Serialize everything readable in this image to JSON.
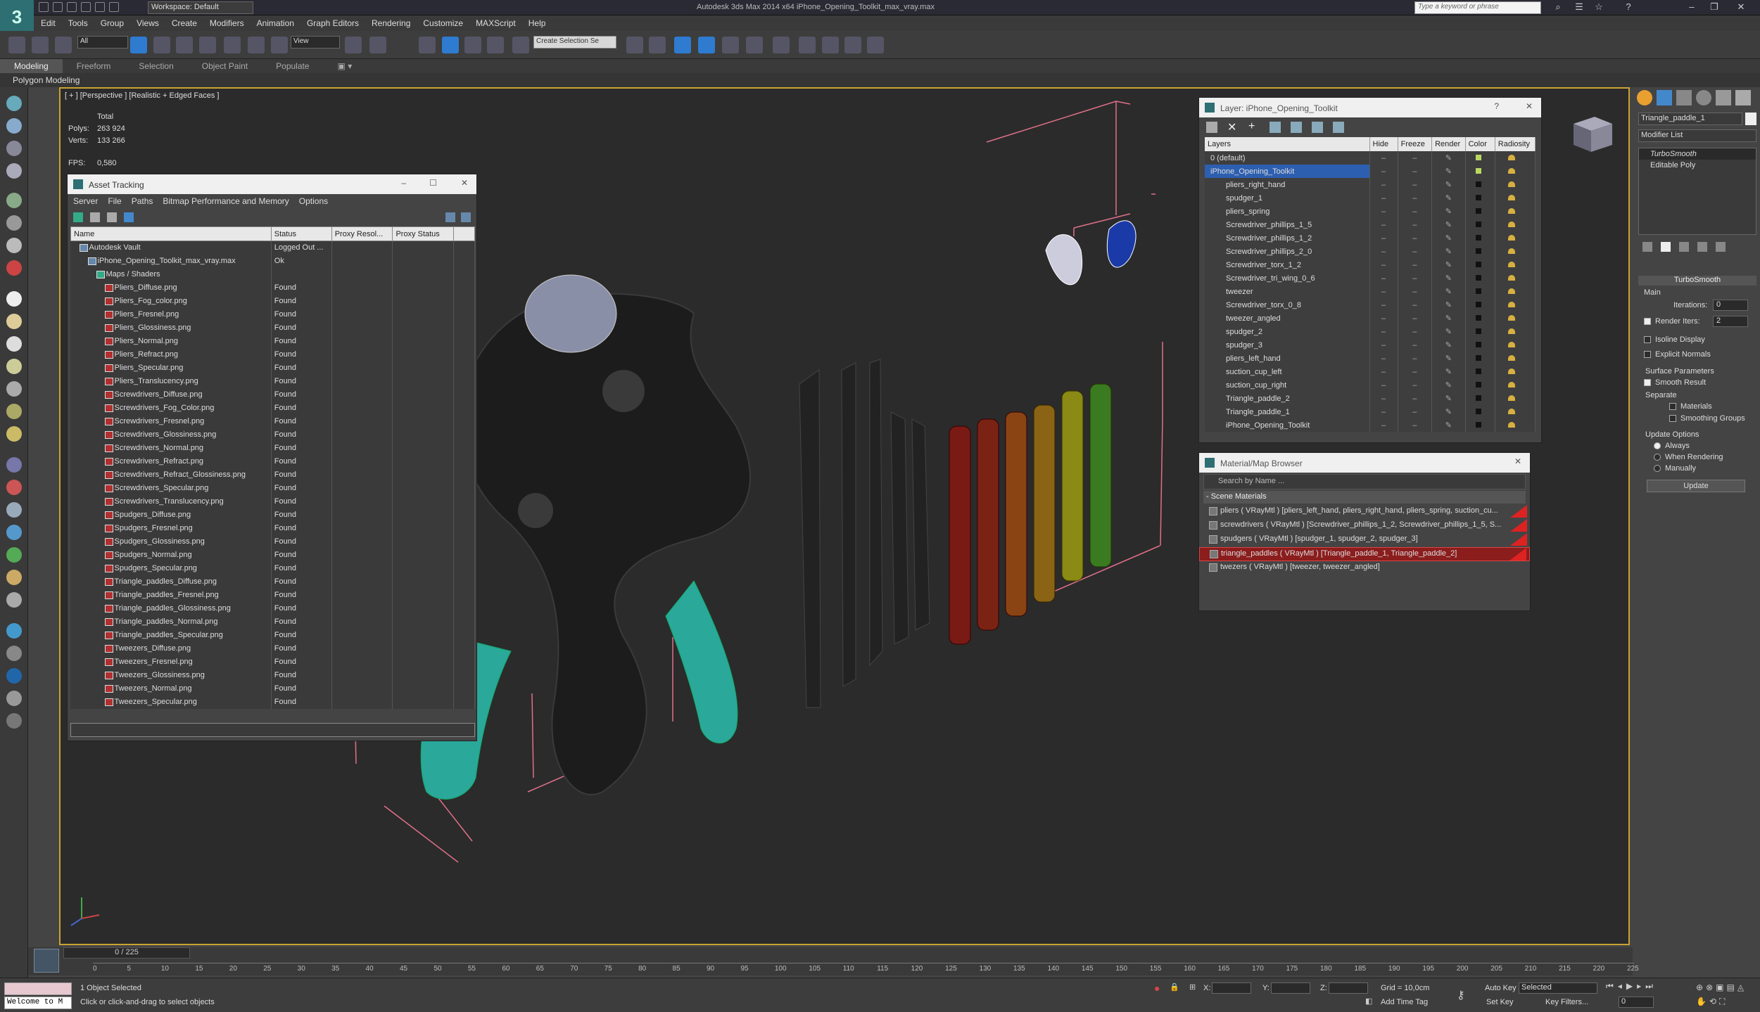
{
  "app": {
    "title": "Autodesk 3ds Max  2014 x64     iPhone_Opening_Toolkit_max_vray.max",
    "workspace": "Workspace: Default",
    "search_placeholder": "Type a keyword or phrase"
  },
  "menu": [
    "Edit",
    "Tools",
    "Group",
    "Views",
    "Create",
    "Modifiers",
    "Animation",
    "Graph Editors",
    "Rendering",
    "Customize",
    "MAXScript",
    "Help"
  ],
  "toolbar": {
    "selection_filter": "All",
    "ref_coord": "View",
    "selection_set": "Create Selection Se"
  },
  "ribbon": {
    "tabs": [
      "Modeling",
      "Freeform",
      "Selection",
      "Object Paint",
      "Populate"
    ],
    "active": "Modeling",
    "sub": "Polygon Modeling"
  },
  "viewport": {
    "label": "[ + ] [Perspective ] [Realistic + Edged Faces ]",
    "total_label": "Total",
    "polys_label": "Polys:",
    "polys_value": "263 924",
    "verts_label": "Verts:",
    "verts_value": "133 266",
    "fps_label": "FPS:",
    "fps_value": "0,580"
  },
  "asset_tracking": {
    "title": "Asset Tracking",
    "menu": [
      "Server",
      "File",
      "Paths",
      "Bitmap Performance and Memory",
      "Options"
    ],
    "columns": [
      "Name",
      "Status",
      "Proxy Resol...",
      "Proxy Status"
    ],
    "rows": [
      {
        "name": "Autodesk Vault",
        "status": "Logged Out ...",
        "indent": 1
      },
      {
        "name": "iPhone_Opening_Toolkit_max_vray.max",
        "status": "Ok",
        "indent": 2
      },
      {
        "name": "Maps / Shaders",
        "status": "",
        "indent": 3
      },
      {
        "name": "Pliers_Diffuse.png",
        "status": "Found",
        "indent": 4
      },
      {
        "name": "Pliers_Fog_color.png",
        "status": "Found",
        "indent": 4
      },
      {
        "name": "Pliers_Fresnel.png",
        "status": "Found",
        "indent": 4
      },
      {
        "name": "Pliers_Glossiness.png",
        "status": "Found",
        "indent": 4
      },
      {
        "name": "Pliers_Normal.png",
        "status": "Found",
        "indent": 4
      },
      {
        "name": "Pliers_Refract.png",
        "status": "Found",
        "indent": 4
      },
      {
        "name": "Pliers_Specular.png",
        "status": "Found",
        "indent": 4
      },
      {
        "name": "Pliers_Translucency.png",
        "status": "Found",
        "indent": 4
      },
      {
        "name": "Screwdrivers_Diffuse.png",
        "status": "Found",
        "indent": 4
      },
      {
        "name": "Screwdrivers_Fog_Color.png",
        "status": "Found",
        "indent": 4
      },
      {
        "name": "Screwdrivers_Fresnel.png",
        "status": "Found",
        "indent": 4
      },
      {
        "name": "Screwdrivers_Glossiness.png",
        "status": "Found",
        "indent": 4
      },
      {
        "name": "Screwdrivers_Normal.png",
        "status": "Found",
        "indent": 4
      },
      {
        "name": "Screwdrivers_Refract.png",
        "status": "Found",
        "indent": 4
      },
      {
        "name": "Screwdrivers_Refract_Glossiness.png",
        "status": "Found",
        "indent": 4
      },
      {
        "name": "Screwdrivers_Specular.png",
        "status": "Found",
        "indent": 4
      },
      {
        "name": "Screwdrivers_Translucency.png",
        "status": "Found",
        "indent": 4
      },
      {
        "name": "Spudgers_Diffuse.png",
        "status": "Found",
        "indent": 4
      },
      {
        "name": "Spudgers_Fresnel.png",
        "status": "Found",
        "indent": 4
      },
      {
        "name": "Spudgers_Glossiness.png",
        "status": "Found",
        "indent": 4
      },
      {
        "name": "Spudgers_Normal.png",
        "status": "Found",
        "indent": 4
      },
      {
        "name": "Spudgers_Specular.png",
        "status": "Found",
        "indent": 4
      },
      {
        "name": "Triangle_paddles_Diffuse.png",
        "status": "Found",
        "indent": 4
      },
      {
        "name": "Triangle_paddles_Fresnel.png",
        "status": "Found",
        "indent": 4
      },
      {
        "name": "Triangle_paddles_Glossiness.png",
        "status": "Found",
        "indent": 4
      },
      {
        "name": "Triangle_paddles_Normal.png",
        "status": "Found",
        "indent": 4
      },
      {
        "name": "Triangle_paddles_Specular.png",
        "status": "Found",
        "indent": 4
      },
      {
        "name": "Tweezers_Diffuse.png",
        "status": "Found",
        "indent": 4
      },
      {
        "name": "Tweezers_Fresnel.png",
        "status": "Found",
        "indent": 4
      },
      {
        "name": "Tweezers_Glossiness.png",
        "status": "Found",
        "indent": 4
      },
      {
        "name": "Tweezers_Normal.png",
        "status": "Found",
        "indent": 4
      },
      {
        "name": "Tweezers_Specular.png",
        "status": "Found",
        "indent": 4
      }
    ]
  },
  "layer_panel": {
    "title": "Layer: iPhone_Opening_Toolkit",
    "columns": [
      "Layers",
      "Hide",
      "Freeze",
      "Render",
      "Color",
      "Radiosity"
    ],
    "rows": [
      {
        "name": "0 (default)",
        "level": 0,
        "color": "#b8d860"
      },
      {
        "name": "iPhone_Opening_Toolkit",
        "level": 0,
        "selected": true,
        "color": "#b8d860"
      },
      {
        "name": "pliers_right_hand",
        "level": 1
      },
      {
        "name": "spudger_1",
        "level": 1
      },
      {
        "name": "pliers_spring",
        "level": 1
      },
      {
        "name": "Screwdriver_phillips_1_5",
        "level": 1
      },
      {
        "name": "Screwdriver_phillips_1_2",
        "level": 1
      },
      {
        "name": "Screwdriver_phillips_2_0",
        "level": 1
      },
      {
        "name": "Screwdriver_torx_1_2",
        "level": 1
      },
      {
        "name": "Screwdriver_tri_wing_0_6",
        "level": 1
      },
      {
        "name": "tweezer",
        "level": 1
      },
      {
        "name": "Screwdriver_torx_0_8",
        "level": 1
      },
      {
        "name": "tweezer_angled",
        "level": 1
      },
      {
        "name": "spudger_2",
        "level": 1
      },
      {
        "name": "spudger_3",
        "level": 1
      },
      {
        "name": "pliers_left_hand",
        "level": 1
      },
      {
        "name": "suction_cup_left",
        "level": 1
      },
      {
        "name": "suction_cup_right",
        "level": 1
      },
      {
        "name": "Triangle_paddle_2",
        "level": 1
      },
      {
        "name": "Triangle_paddle_1",
        "level": 1
      },
      {
        "name": "iPhone_Opening_Toolkit",
        "level": 1
      }
    ]
  },
  "material_browser": {
    "title": "Material/Map Browser",
    "search_placeholder": "Search by Name ...",
    "group": "- Scene Materials",
    "rows": [
      {
        "text": "pliers ( VRayMtl ) [pliers_left_hand, pliers_right_hand, pliers_spring, suction_cu...",
        "red": true
      },
      {
        "text": "screwdrivers ( VRayMtl ) [Screwdriver_phillips_1_2, Screwdriver_phillips_1_5, S...",
        "red": true
      },
      {
        "text": "spudgers ( VRayMtl ) [spudger_1, spudger_2, spudger_3]",
        "red": true
      },
      {
        "text": "triangle_paddles ( VRayMtl ) [Triangle_paddle_1, Triangle_paddle_2]",
        "red": true,
        "selected": true
      },
      {
        "text": "twezers ( VRayMtl ) [tweezer, tweezer_angled]",
        "red": false
      }
    ]
  },
  "command_panel": {
    "object_name": "Triangle_paddle_1",
    "modifier_list": "Modifier List",
    "stack": [
      "TurboSmooth",
      "Editable Poly"
    ],
    "rollout_title": "TurboSmooth",
    "main_label": "Main",
    "iterations_label": "Iterations:",
    "iterations_value": "0",
    "render_iters_label": "Render Iters:",
    "render_iters_value": "2",
    "isoline": "Isoline Display",
    "explicit": "Explicit Normals",
    "surface_params": "Surface Parameters",
    "smooth_result": "Smooth Result",
    "separate": "Separate",
    "materials": "Materials",
    "smoothing_groups": "Smoothing Groups",
    "update_options": "Update Options",
    "always": "Always",
    "when_rendering": "When Rendering",
    "manually": "Manually",
    "update_btn": "Update"
  },
  "timeline": {
    "frame": "0 / 225",
    "ticks": [
      "0",
      "5",
      "10",
      "15",
      "20",
      "25",
      "30",
      "35",
      "40",
      "45",
      "50",
      "55",
      "60",
      "65",
      "70",
      "75",
      "80",
      "85",
      "90",
      "95",
      "100",
      "105",
      "110",
      "115",
      "120",
      "125",
      "130",
      "135",
      "140",
      "145",
      "150",
      "155",
      "160",
      "165",
      "170",
      "175",
      "180",
      "185",
      "190",
      "195",
      "200",
      "205",
      "210",
      "215",
      "220",
      "225"
    ]
  },
  "status": {
    "welcome": "Welcome to M",
    "selected": "1 Object Selected",
    "hint": "Click or click-and-drag to select objects",
    "x_label": "X:",
    "y_label": "Y:",
    "z_label": "Z:",
    "grid": "Grid = 10,0cm",
    "add_time_tag": "Add Time Tag",
    "auto_key": "Auto Key",
    "set_key": "Set Key",
    "key_mode": "Selected",
    "key_filters": "Key Filters...",
    "frame_value": "0"
  },
  "colors": {
    "teal": "#2aa89a",
    "viewport_border": "#c9a331",
    "selection_bbox": "#e0708a",
    "layer_selected": "#2d5fb0"
  }
}
